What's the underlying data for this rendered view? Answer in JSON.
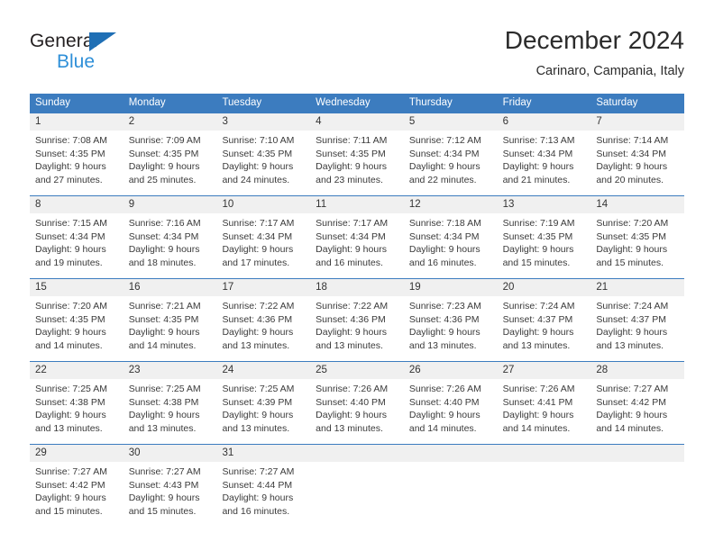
{
  "brand": {
    "name_part1": "General",
    "name_part2": "Blue",
    "triangle_color": "#1f6fb5",
    "blue_text_color": "#2e8fd8"
  },
  "header": {
    "title": "December 2024",
    "location": "Carinaro, Campania, Italy"
  },
  "theme": {
    "header_blue": "#3c7cbf",
    "daynum_band": "#f0f0f0",
    "text": "#3a3a3a"
  },
  "weekday_headers": [
    "Sunday",
    "Monday",
    "Tuesday",
    "Wednesday",
    "Thursday",
    "Friday",
    "Saturday"
  ],
  "weeks": [
    {
      "days": [
        {
          "num": "1",
          "sunrise": "Sunrise: 7:08 AM",
          "sunset": "Sunset: 4:35 PM",
          "daylight1": "Daylight: 9 hours",
          "daylight2": "and 27 minutes."
        },
        {
          "num": "2",
          "sunrise": "Sunrise: 7:09 AM",
          "sunset": "Sunset: 4:35 PM",
          "daylight1": "Daylight: 9 hours",
          "daylight2": "and 25 minutes."
        },
        {
          "num": "3",
          "sunrise": "Sunrise: 7:10 AM",
          "sunset": "Sunset: 4:35 PM",
          "daylight1": "Daylight: 9 hours",
          "daylight2": "and 24 minutes."
        },
        {
          "num": "4",
          "sunrise": "Sunrise: 7:11 AM",
          "sunset": "Sunset: 4:35 PM",
          "daylight1": "Daylight: 9 hours",
          "daylight2": "and 23 minutes."
        },
        {
          "num": "5",
          "sunrise": "Sunrise: 7:12 AM",
          "sunset": "Sunset: 4:34 PM",
          "daylight1": "Daylight: 9 hours",
          "daylight2": "and 22 minutes."
        },
        {
          "num": "6",
          "sunrise": "Sunrise: 7:13 AM",
          "sunset": "Sunset: 4:34 PM",
          "daylight1": "Daylight: 9 hours",
          "daylight2": "and 21 minutes."
        },
        {
          "num": "7",
          "sunrise": "Sunrise: 7:14 AM",
          "sunset": "Sunset: 4:34 PM",
          "daylight1": "Daylight: 9 hours",
          "daylight2": "and 20 minutes."
        }
      ]
    },
    {
      "days": [
        {
          "num": "8",
          "sunrise": "Sunrise: 7:15 AM",
          "sunset": "Sunset: 4:34 PM",
          "daylight1": "Daylight: 9 hours",
          "daylight2": "and 19 minutes."
        },
        {
          "num": "9",
          "sunrise": "Sunrise: 7:16 AM",
          "sunset": "Sunset: 4:34 PM",
          "daylight1": "Daylight: 9 hours",
          "daylight2": "and 18 minutes."
        },
        {
          "num": "10",
          "sunrise": "Sunrise: 7:17 AM",
          "sunset": "Sunset: 4:34 PM",
          "daylight1": "Daylight: 9 hours",
          "daylight2": "and 17 minutes."
        },
        {
          "num": "11",
          "sunrise": "Sunrise: 7:17 AM",
          "sunset": "Sunset: 4:34 PM",
          "daylight1": "Daylight: 9 hours",
          "daylight2": "and 16 minutes."
        },
        {
          "num": "12",
          "sunrise": "Sunrise: 7:18 AM",
          "sunset": "Sunset: 4:34 PM",
          "daylight1": "Daylight: 9 hours",
          "daylight2": "and 16 minutes."
        },
        {
          "num": "13",
          "sunrise": "Sunrise: 7:19 AM",
          "sunset": "Sunset: 4:35 PM",
          "daylight1": "Daylight: 9 hours",
          "daylight2": "and 15 minutes."
        },
        {
          "num": "14",
          "sunrise": "Sunrise: 7:20 AM",
          "sunset": "Sunset: 4:35 PM",
          "daylight1": "Daylight: 9 hours",
          "daylight2": "and 15 minutes."
        }
      ]
    },
    {
      "days": [
        {
          "num": "15",
          "sunrise": "Sunrise: 7:20 AM",
          "sunset": "Sunset: 4:35 PM",
          "daylight1": "Daylight: 9 hours",
          "daylight2": "and 14 minutes."
        },
        {
          "num": "16",
          "sunrise": "Sunrise: 7:21 AM",
          "sunset": "Sunset: 4:35 PM",
          "daylight1": "Daylight: 9 hours",
          "daylight2": "and 14 minutes."
        },
        {
          "num": "17",
          "sunrise": "Sunrise: 7:22 AM",
          "sunset": "Sunset: 4:36 PM",
          "daylight1": "Daylight: 9 hours",
          "daylight2": "and 13 minutes."
        },
        {
          "num": "18",
          "sunrise": "Sunrise: 7:22 AM",
          "sunset": "Sunset: 4:36 PM",
          "daylight1": "Daylight: 9 hours",
          "daylight2": "and 13 minutes."
        },
        {
          "num": "19",
          "sunrise": "Sunrise: 7:23 AM",
          "sunset": "Sunset: 4:36 PM",
          "daylight1": "Daylight: 9 hours",
          "daylight2": "and 13 minutes."
        },
        {
          "num": "20",
          "sunrise": "Sunrise: 7:24 AM",
          "sunset": "Sunset: 4:37 PM",
          "daylight1": "Daylight: 9 hours",
          "daylight2": "and 13 minutes."
        },
        {
          "num": "21",
          "sunrise": "Sunrise: 7:24 AM",
          "sunset": "Sunset: 4:37 PM",
          "daylight1": "Daylight: 9 hours",
          "daylight2": "and 13 minutes."
        }
      ]
    },
    {
      "days": [
        {
          "num": "22",
          "sunrise": "Sunrise: 7:25 AM",
          "sunset": "Sunset: 4:38 PM",
          "daylight1": "Daylight: 9 hours",
          "daylight2": "and 13 minutes."
        },
        {
          "num": "23",
          "sunrise": "Sunrise: 7:25 AM",
          "sunset": "Sunset: 4:38 PM",
          "daylight1": "Daylight: 9 hours",
          "daylight2": "and 13 minutes."
        },
        {
          "num": "24",
          "sunrise": "Sunrise: 7:25 AM",
          "sunset": "Sunset: 4:39 PM",
          "daylight1": "Daylight: 9 hours",
          "daylight2": "and 13 minutes."
        },
        {
          "num": "25",
          "sunrise": "Sunrise: 7:26 AM",
          "sunset": "Sunset: 4:40 PM",
          "daylight1": "Daylight: 9 hours",
          "daylight2": "and 13 minutes."
        },
        {
          "num": "26",
          "sunrise": "Sunrise: 7:26 AM",
          "sunset": "Sunset: 4:40 PM",
          "daylight1": "Daylight: 9 hours",
          "daylight2": "and 14 minutes."
        },
        {
          "num": "27",
          "sunrise": "Sunrise: 7:26 AM",
          "sunset": "Sunset: 4:41 PM",
          "daylight1": "Daylight: 9 hours",
          "daylight2": "and 14 minutes."
        },
        {
          "num": "28",
          "sunrise": "Sunrise: 7:27 AM",
          "sunset": "Sunset: 4:42 PM",
          "daylight1": "Daylight: 9 hours",
          "daylight2": "and 14 minutes."
        }
      ]
    },
    {
      "days": [
        {
          "num": "29",
          "sunrise": "Sunrise: 7:27 AM",
          "sunset": "Sunset: 4:42 PM",
          "daylight1": "Daylight: 9 hours",
          "daylight2": "and 15 minutes."
        },
        {
          "num": "30",
          "sunrise": "Sunrise: 7:27 AM",
          "sunset": "Sunset: 4:43 PM",
          "daylight1": "Daylight: 9 hours",
          "daylight2": "and 15 minutes."
        },
        {
          "num": "31",
          "sunrise": "Sunrise: 7:27 AM",
          "sunset": "Sunset: 4:44 PM",
          "daylight1": "Daylight: 9 hours",
          "daylight2": "and 16 minutes."
        },
        {
          "num": "",
          "sunrise": "",
          "sunset": "",
          "daylight1": "",
          "daylight2": ""
        },
        {
          "num": "",
          "sunrise": "",
          "sunset": "",
          "daylight1": "",
          "daylight2": ""
        },
        {
          "num": "",
          "sunrise": "",
          "sunset": "",
          "daylight1": "",
          "daylight2": ""
        },
        {
          "num": "",
          "sunrise": "",
          "sunset": "",
          "daylight1": "",
          "daylight2": ""
        }
      ]
    }
  ]
}
